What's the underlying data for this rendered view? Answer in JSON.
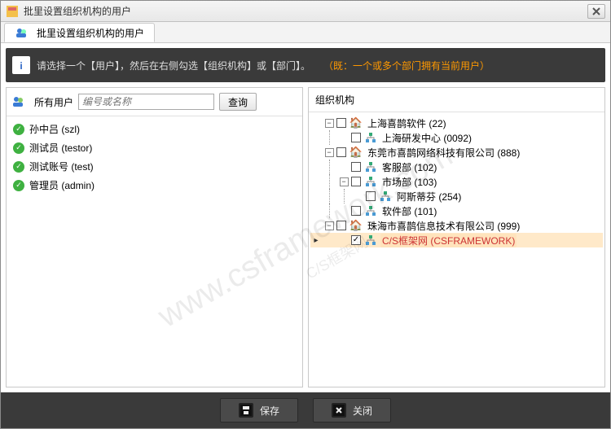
{
  "title": "批里设置组织机构的用户",
  "tab_label": "批里设置组织机构的用户",
  "hint_main": "请选择一个【用户】，然后在右侧勾选【组织机构】或【部门】。",
  "hint_extra": "（既：一个或多个部门拥有当前用户）",
  "left": {
    "all_users_label": "所有用户",
    "search_placeholder": "编号或名称",
    "search_btn": "查询",
    "users": [
      {
        "label": "孙中吕 (szl)"
      },
      {
        "label": "测试员 (testor)"
      },
      {
        "label": "测试账号 (test)"
      },
      {
        "label": "管理员 (admin)"
      }
    ]
  },
  "right": {
    "heading": "组织机构",
    "tree": {
      "n0": {
        "label": "上海喜鹊软件 (22)",
        "expanded": true,
        "checked": false,
        "icon": "house"
      },
      "n0_0": {
        "label": "上海研发中心 (0092)",
        "checked": false,
        "icon": "org"
      },
      "n1": {
        "label": "东莞市喜鹊网络科技有限公司 (888)",
        "expanded": true,
        "checked": false,
        "icon": "house"
      },
      "n1_0": {
        "label": "客服部 (102)",
        "checked": false,
        "icon": "org"
      },
      "n1_1": {
        "label": "市场部 (103)",
        "expanded": true,
        "checked": false,
        "icon": "org"
      },
      "n1_1_0": {
        "label": "阿斯蒂芬 (254)",
        "checked": false,
        "icon": "org"
      },
      "n1_2": {
        "label": "软件部 (101)",
        "checked": false,
        "icon": "org"
      },
      "n2": {
        "label": "珠海市喜鹊信息技术有限公司 (999)",
        "expanded": true,
        "checked": false,
        "icon": "house"
      },
      "n2_0": {
        "label": "C/S框架网 (CSFRAMEWORK)",
        "checked": true,
        "icon": "org",
        "selected": true
      }
    }
  },
  "footer": {
    "save": "保存",
    "close": "关闭"
  },
  "watermark1": "www.csframework.com",
  "watermark2": "C/S框架网"
}
